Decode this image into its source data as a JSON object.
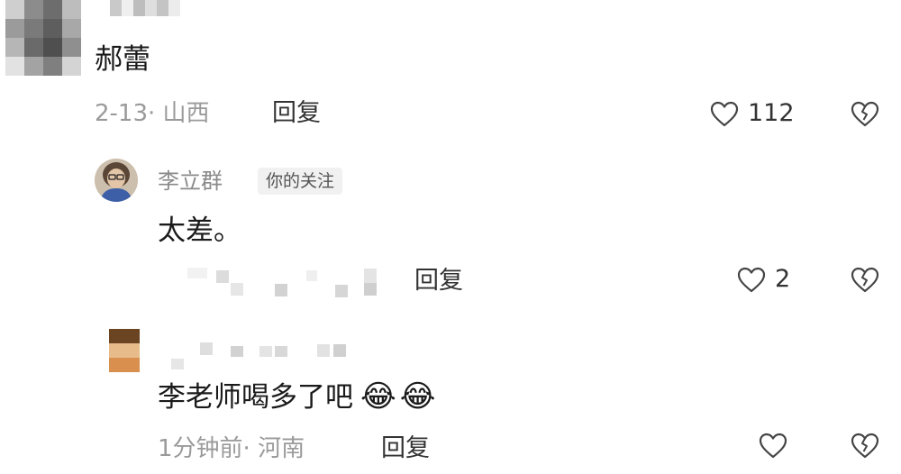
{
  "comments": [
    {
      "name_partial": "",
      "body": "郝蕾",
      "date": "2-13",
      "separator": "·",
      "location": "山西",
      "reply_label": "回复",
      "likes": "112"
    },
    {
      "name": "李立群",
      "tag": "你的关注",
      "body": "太差。",
      "reply_label": "回复",
      "likes": "2"
    },
    {
      "body": "李老师喝多了吧",
      "emoji": "😂😂",
      "time": "1分钟前",
      "separator": "·",
      "location": "河南",
      "reply_label": "回复",
      "likes": ""
    }
  ],
  "icons": {
    "like": "heart-outline-icon",
    "dislike": "broken-heart-icon"
  },
  "colors": {
    "meta_gray": "#9a9a9a",
    "name_gray": "#8a8a8a",
    "text_dark": "#1a1a1a",
    "tag_bg": "#f1f1f1"
  }
}
